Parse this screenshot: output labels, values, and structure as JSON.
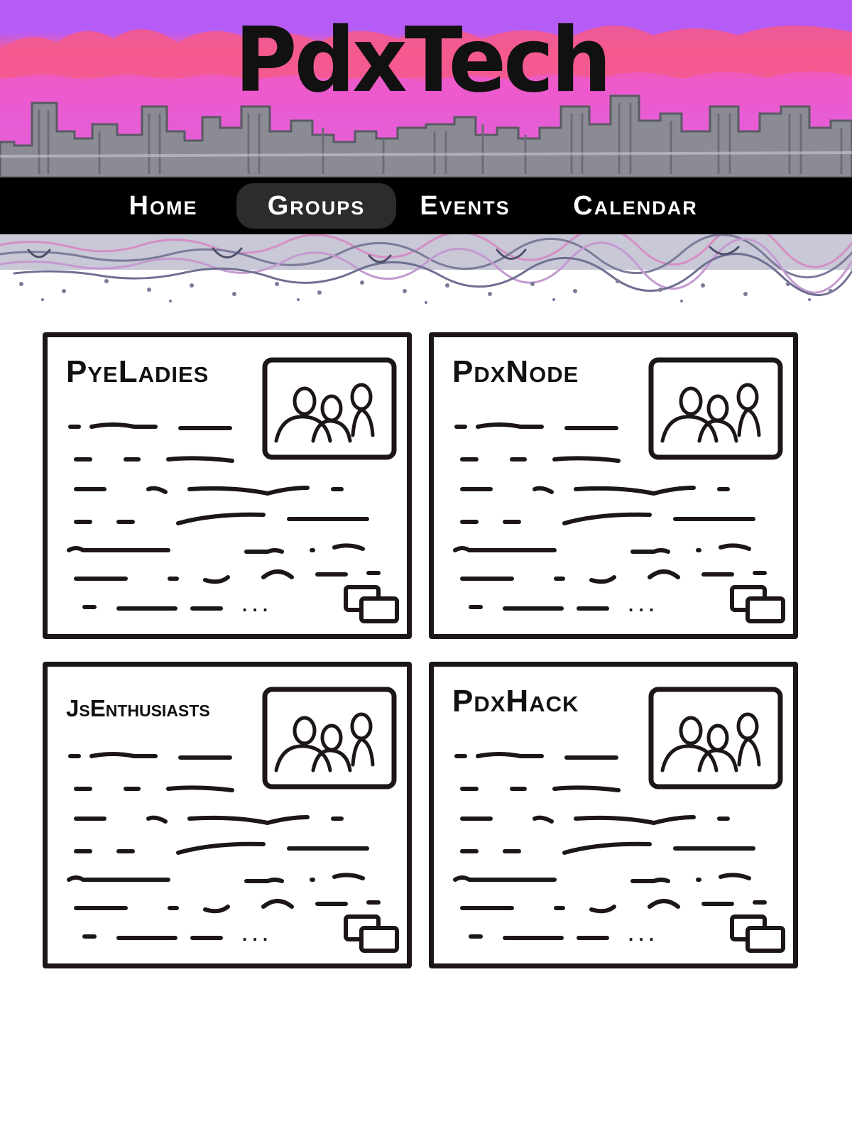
{
  "header": {
    "site_title": "PdxTech",
    "colors": {
      "sky_top": "#b65cf6",
      "sky_red": "#f45a9a",
      "sky_pink": "#e85cd4",
      "skyline": "#8b8b93",
      "nav_bg": "#000000",
      "nav_active_bg": "#2c2c2c"
    }
  },
  "nav": {
    "items": [
      {
        "label": "Home"
      },
      {
        "label": "Groups"
      },
      {
        "label": "Events"
      },
      {
        "label": "Calendar"
      }
    ],
    "active": "Groups"
  },
  "groups": [
    {
      "name": "PyeLadies",
      "image": "group-photo-icon",
      "more": "more-icon"
    },
    {
      "name": "PdxNode",
      "image": "group-photo-icon",
      "more": "more-icon"
    },
    {
      "name": "JsEnthusiasts",
      "image": "group-photo-icon",
      "more": "more-icon"
    },
    {
      "name": "PdxHack",
      "image": "group-photo-icon",
      "more": "more-icon"
    }
  ],
  "placeholder_text": {
    "ellipsis": ". . ."
  }
}
